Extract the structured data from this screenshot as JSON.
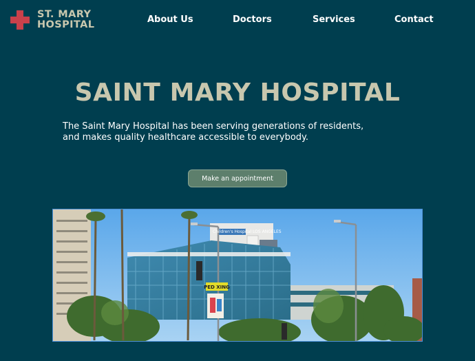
{
  "header": {
    "logo_line1": "ST. MARY",
    "logo_line2": "HOSPITAL",
    "logo_icon": "medical-cross-icon",
    "nav": [
      {
        "label": "About Us"
      },
      {
        "label": "Doctors"
      },
      {
        "label": "Services"
      },
      {
        "label": "Contact"
      }
    ]
  },
  "hero": {
    "title": "SAINT MARY HOSPITAL",
    "subtitle_line1": "The Saint Mary Hospital has been serving generations of residents,",
    "subtitle_line2": "and makes quality healthcare accessible to everybody.",
    "cta_label": "Make an appointment",
    "photo": {
      "building_sign": "Children's Hospital LOS ANGELES",
      "street_sign": "PED XING"
    }
  },
  "colors": {
    "background": "#003e4f",
    "accent_beige": "#c8c7ae",
    "cross_red": "#c9414b",
    "button_green": "#5d7f6c",
    "image_border": "#4c8fd6"
  }
}
